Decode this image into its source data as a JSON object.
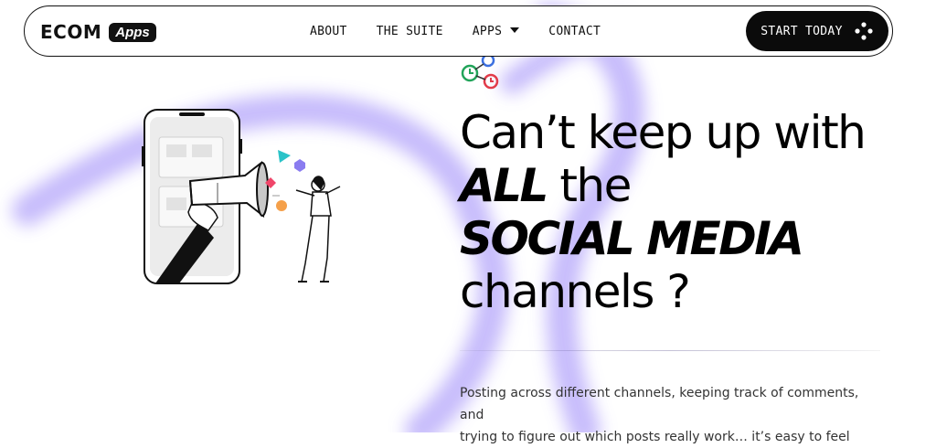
{
  "nav": {
    "logo_text": "ECOM",
    "logo_badge": "Apps",
    "menu": {
      "about": "ABOUT",
      "suite": "THE SUITE",
      "apps": "APPS",
      "contact": "CONTACT"
    },
    "cta_label": "START TODAY"
  },
  "hero": {
    "line1": "Can’t keep up with",
    "line2_bold": "ALL",
    "line2_rest": " the",
    "line3_bold": "SOCIAL MEDIA",
    "line4": "channels ?",
    "body_line1": "Posting across different channels, keeping track of comments, and",
    "body_line2": "trying to figure out which posts really work… it’s easy to feel"
  },
  "colors": {
    "accent_purple": "#b9aef7",
    "cta_bg": "#0b0b0b"
  }
}
